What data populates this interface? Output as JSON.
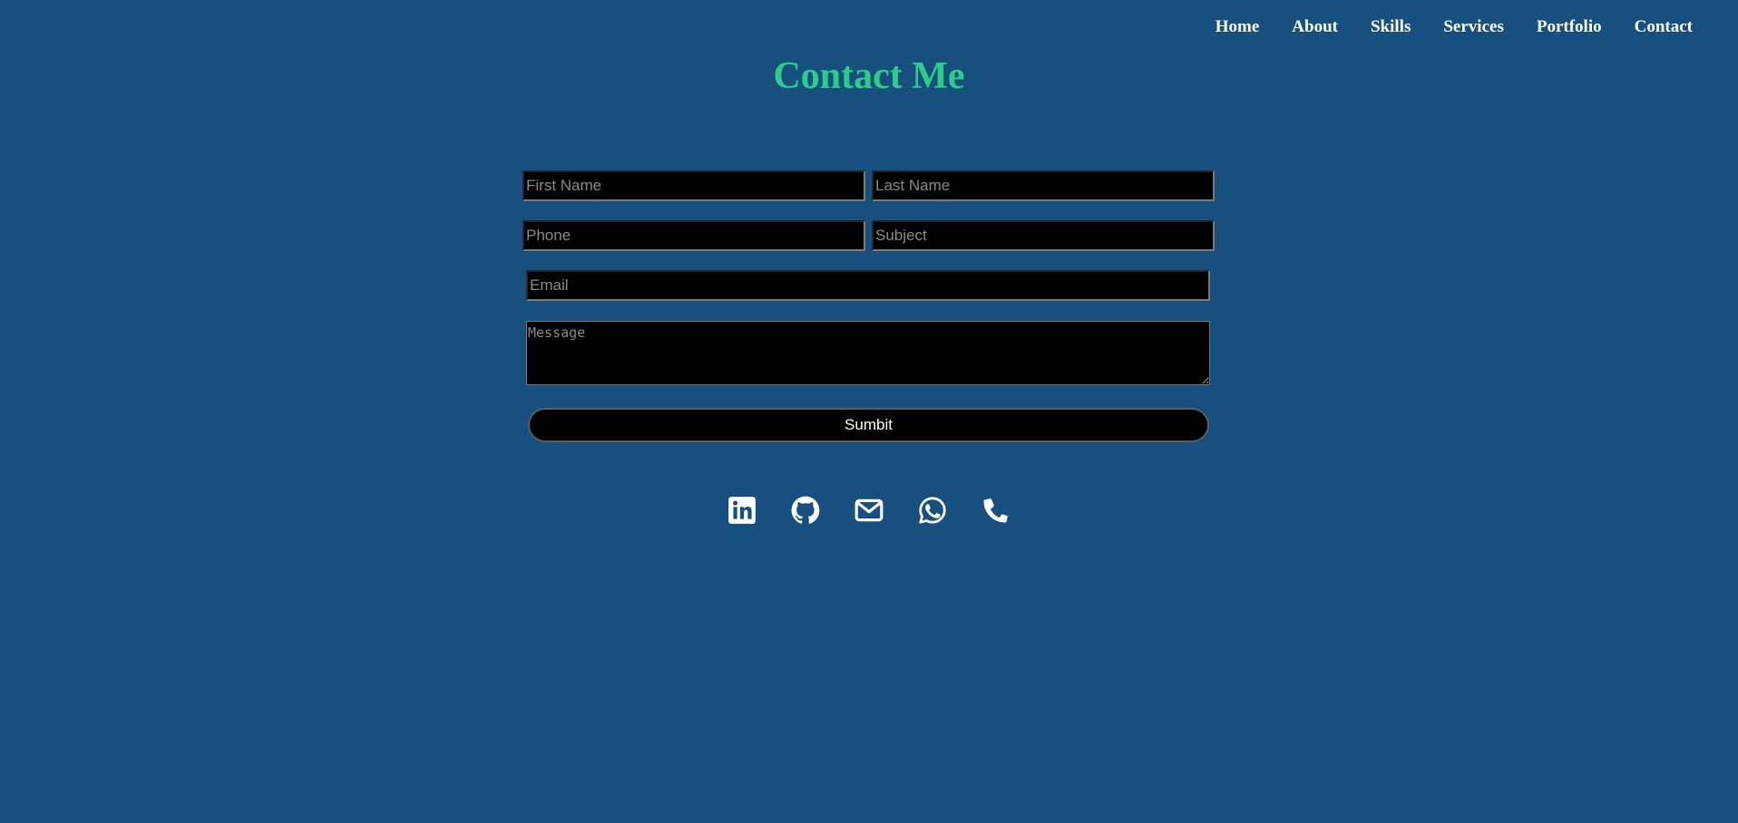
{
  "nav": {
    "items": [
      {
        "label": "Home"
      },
      {
        "label": "About"
      },
      {
        "label": "Skills"
      },
      {
        "label": "Services"
      },
      {
        "label": "Portfolio"
      },
      {
        "label": "Contact"
      }
    ]
  },
  "page": {
    "title": "Contact Me"
  },
  "form": {
    "first_name_placeholder": "First Name",
    "last_name_placeholder": "Last Name",
    "phone_placeholder": "Phone",
    "subject_placeholder": "Subject",
    "email_placeholder": "Email",
    "message_placeholder": "Message",
    "submit_label": "Sumbit"
  },
  "socials": {
    "icons": [
      "linkedin-icon",
      "github-icon",
      "envelope-icon",
      "whatsapp-icon",
      "phone-icon"
    ]
  },
  "colors": {
    "background": "#174f7e",
    "title": "#2ecc8b",
    "nav_text": "#ffffff",
    "field_background": "#000000",
    "icon": "#ffffff"
  }
}
